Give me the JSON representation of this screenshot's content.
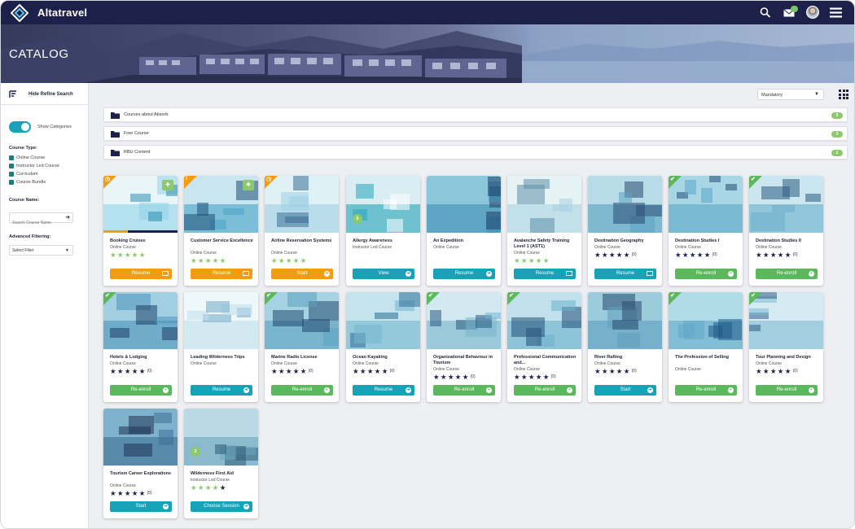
{
  "app": {
    "brand": "Altatravel",
    "banner_title": "CATALOG"
  },
  "sidebar": {
    "refine_label": "Hide Refine Search",
    "show_categories_label": "Show Categories",
    "show_categories_on": true,
    "course_type_heading": "Course Type:",
    "course_types": [
      "Online Course",
      "Instructor Led Course",
      "Curriculum",
      "Course Bundle"
    ],
    "course_name_heading": "Course Name:",
    "course_name_placeholder": "Search Course Name",
    "advanced_filtering_heading": "Advanced Filtering:",
    "filter_selected": "Select Filter"
  },
  "toolbar": {
    "sort_selected": "Mandatory"
  },
  "categories": [
    {
      "label": "Courses about Absorb",
      "count": "2"
    },
    {
      "label": "Free Course",
      "count": "3"
    },
    {
      "label": "RBU Content",
      "count": "1"
    }
  ],
  "colors": {
    "navy": "#1d2048",
    "orange": "#f39c12",
    "teal": "#17a2b8",
    "green": "#5cb85c",
    "badge_green": "#8bc96c"
  },
  "cards": [
    {
      "title": "Booking Cruises",
      "type": "Online Course",
      "rating": 5,
      "rating_style": "green",
      "rating_count": "",
      "button": "Resume",
      "button_color": "orange",
      "button_icon": "monitor-icon",
      "corner": "clock",
      "pinned": true,
      "progress": 0.33
    },
    {
      "title": "Customer Service Excellence",
      "type": "Online Course",
      "rating": 5,
      "rating_style": "green",
      "rating_count": "",
      "button": "Resume",
      "button_color": "orange",
      "button_icon": "monitor-icon",
      "corner": "exclamation",
      "pinned": true,
      "progress": 0
    },
    {
      "title": "Airline Reservation Systems",
      "type": "Online Course",
      "rating": 5,
      "rating_style": "green",
      "rating_count": "",
      "button": "Start",
      "button_color": "orange",
      "button_icon": "arrow-icon",
      "corner": "clock",
      "pinned": false,
      "progress": 0
    },
    {
      "title": "Allergy Awareness",
      "type": "Instructor Led Course",
      "rating": 0,
      "rating_style": "none",
      "rating_count": "",
      "button": "View",
      "button_color": "teal",
      "button_icon": "arrow-icon",
      "corner": "",
      "pinned": false,
      "progress": 0,
      "thumb_badge": "0"
    },
    {
      "title": "An Expedition",
      "type": "Online Course",
      "rating": 0,
      "rating_style": "none",
      "rating_count": "",
      "button": "Resume",
      "button_color": "teal",
      "button_icon": "arrow-icon",
      "corner": "",
      "pinned": false,
      "progress": 0
    },
    {
      "title": "Avalanche Safety Training Level 1 (AST1)",
      "type": "Online Course",
      "rating": 5,
      "rating_style": "green",
      "rating_count": "",
      "button": "Resume",
      "button_color": "teal",
      "button_icon": "monitor-icon",
      "corner": "",
      "pinned": false,
      "progress": 0
    },
    {
      "title": "Destination Geography",
      "type": "Online Course",
      "rating": 5,
      "rating_style": "navy",
      "rating_count": "(0)",
      "button": "Resume",
      "button_color": "teal",
      "button_icon": "monitor-icon",
      "corner": "",
      "pinned": false,
      "progress": 0
    },
    {
      "title": "Destination Studies I",
      "type": "Online Course",
      "rating": 5,
      "rating_style": "navy",
      "rating_count": "(0)",
      "button": "Re-enroll",
      "button_color": "green",
      "button_icon": "plus-icon",
      "corner": "check",
      "pinned": false,
      "progress": 0
    },
    {
      "title": "Destination Studies II",
      "type": "Online Course",
      "rating": 5,
      "rating_style": "navy",
      "rating_count": "(0)",
      "button": "Re-enroll",
      "button_color": "green",
      "button_icon": "plus-icon",
      "corner": "check",
      "pinned": false,
      "progress": 0
    },
    {
      "title": "Hotels & Lodging",
      "type": "Online Course",
      "rating": 5,
      "rating_style": "navy",
      "rating_count": "(0)",
      "button": "Re-enroll",
      "button_color": "green",
      "button_icon": "plus-icon",
      "corner": "check",
      "pinned": false,
      "progress": 0
    },
    {
      "title": "Leading Wilderness Trips",
      "type": "Online Course",
      "rating": 0,
      "rating_style": "none",
      "rating_count": "",
      "button": "Resume",
      "button_color": "teal",
      "button_icon": "arrow-icon",
      "corner": "",
      "pinned": false,
      "progress": 0
    },
    {
      "title": "Marine Radio License",
      "type": "Online Course",
      "rating": 5,
      "rating_style": "navy",
      "rating_count": "(0)",
      "button": "Re-enroll",
      "button_color": "green",
      "button_icon": "plus-icon",
      "corner": "check",
      "pinned": false,
      "progress": 0
    },
    {
      "title": "Ocean Kayaking",
      "type": "Online Course",
      "rating": 5,
      "rating_style": "navy",
      "rating_count": "(0)",
      "button": "Resume",
      "button_color": "teal",
      "button_icon": "arrow-icon",
      "corner": "",
      "pinned": false,
      "progress": 0
    },
    {
      "title": "Organizational Behaviour in Tourism",
      "type": "Online Course",
      "rating": 5,
      "rating_style": "navy",
      "rating_count": "(0)",
      "button": "Re-enroll",
      "button_color": "green",
      "button_icon": "plus-icon",
      "corner": "check",
      "pinned": false,
      "progress": 0
    },
    {
      "title": "Professional Communication and...",
      "type": "Online Course",
      "rating": 5,
      "rating_style": "navy",
      "rating_count": "(0)",
      "button": "Re-enroll",
      "button_color": "green",
      "button_icon": "plus-icon",
      "corner": "check",
      "pinned": false,
      "progress": 0
    },
    {
      "title": "River Rafting",
      "type": "Online Course",
      "rating": 5,
      "rating_style": "navy",
      "rating_count": "(0)",
      "button": "Start",
      "button_color": "teal",
      "button_icon": "arrow-icon",
      "corner": "",
      "pinned": false,
      "progress": 0
    },
    {
      "title": "The Profession of Selling",
      "type": "Online Course",
      "rating": 0,
      "rating_style": "none",
      "rating_count": "",
      "button": "Re-enroll",
      "button_color": "green",
      "button_icon": "plus-icon",
      "corner": "check",
      "pinned": false,
      "progress": 0
    },
    {
      "title": "Tour Planning and Design",
      "type": "Online Course",
      "rating": 5,
      "rating_style": "navy",
      "rating_count": "(0)",
      "button": "Re-enroll",
      "button_color": "green",
      "button_icon": "plus-icon",
      "corner": "check",
      "pinned": false,
      "progress": 0
    },
    {
      "title": "Tourism Career Explorations",
      "type": "Online Course",
      "rating": 5,
      "rating_style": "navy",
      "rating_count": "(0)",
      "button": "Start",
      "button_color": "teal",
      "button_icon": "arrow-icon",
      "corner": "",
      "pinned": false,
      "progress": 0
    },
    {
      "title": "Wilderness First Aid",
      "type": "Instructor Led Course",
      "rating": 4,
      "rating_style": "green",
      "rating_count": "",
      "button": "Choose Session",
      "button_color": "teal",
      "button_icon": "arrow-icon",
      "corner": "",
      "pinned": false,
      "progress": 0,
      "thumb_badge": "2"
    }
  ]
}
